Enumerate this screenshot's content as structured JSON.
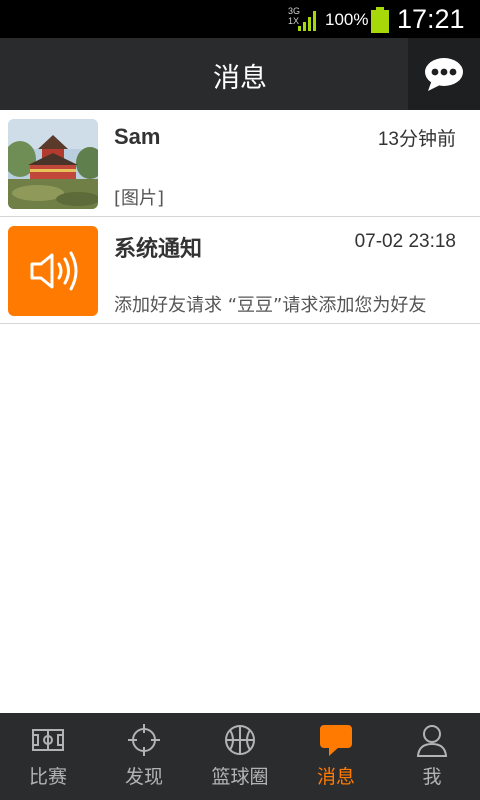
{
  "status_bar": {
    "network_top": "3G",
    "network_bottom": "1X",
    "battery_percent": "100%",
    "time": "17:21",
    "icons": [
      "signal-icon",
      "battery-icon"
    ]
  },
  "header": {
    "title": "消息",
    "action_icon": "chat-bubble-icon"
  },
  "messages": [
    {
      "name": "Sam",
      "time": "13分钟前",
      "preview": "[图片]",
      "avatar": "photo-avatar"
    },
    {
      "name": "系统通知",
      "time": "07-02 23:18",
      "preview": "添加好友请求 “豆豆”请求添加您为好友",
      "avatar": "speaker-icon"
    }
  ],
  "bottom_nav": {
    "active_color": "#ff7a00",
    "items": [
      {
        "label": "比赛",
        "icon": "court-icon"
      },
      {
        "label": "发现",
        "icon": "crosshair-icon"
      },
      {
        "label": "篮球圈",
        "icon": "basketball-icon"
      },
      {
        "label": "消息",
        "icon": "message-icon",
        "active": true
      },
      {
        "label": "我",
        "icon": "person-icon"
      }
    ]
  },
  "colors": {
    "accent": "#ff7a00",
    "header_bg": "#2a2b2d",
    "nav_bg": "#2b2c2e"
  }
}
